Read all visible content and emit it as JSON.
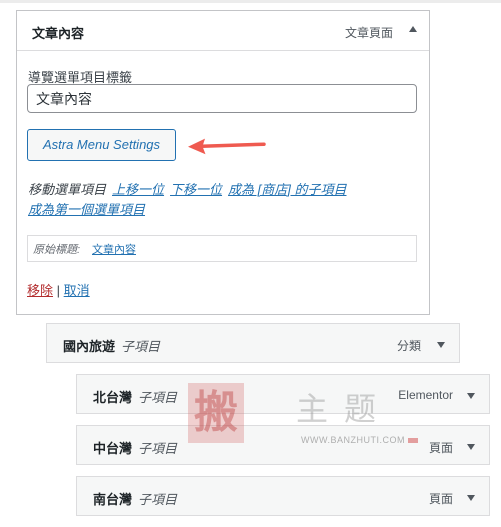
{
  "active_item": {
    "title": "文章內容",
    "type_label": "文章頁面",
    "nav_label_caption": "導覽選單項目標籤",
    "nav_label_value": "文章內容",
    "astra_button_label": "Astra Menu Settings",
    "move_label": "移動選單項目",
    "move_links": [
      "上移一位",
      "下移一位",
      "成為 [商店] 的子項目"
    ],
    "move_top_link": "成為第一個選單項目",
    "original_label": "原始標題:",
    "original_value": "文章內容",
    "remove_label": "移除",
    "separator": "|",
    "cancel_label": "取消"
  },
  "collapsed_items": [
    {
      "title": "國內旅遊",
      "sub": "子項目",
      "type": "分類"
    },
    {
      "title": "北台灣",
      "sub": "子項目",
      "type": "Elementor"
    },
    {
      "title": "中台灣",
      "sub": "子項目",
      "type": "頁面"
    },
    {
      "title": "南台灣",
      "sub": "子項目",
      "type": "頁面"
    }
  ],
  "watermark": {
    "seal_char": "搬",
    "brand": "主题",
    "url": "WWW.BANZHUTI.COM"
  },
  "colors": {
    "link": "#2271b1",
    "remove": "#b32d2e",
    "arrow": "#ef5a50",
    "border": "#c3c4c7"
  }
}
